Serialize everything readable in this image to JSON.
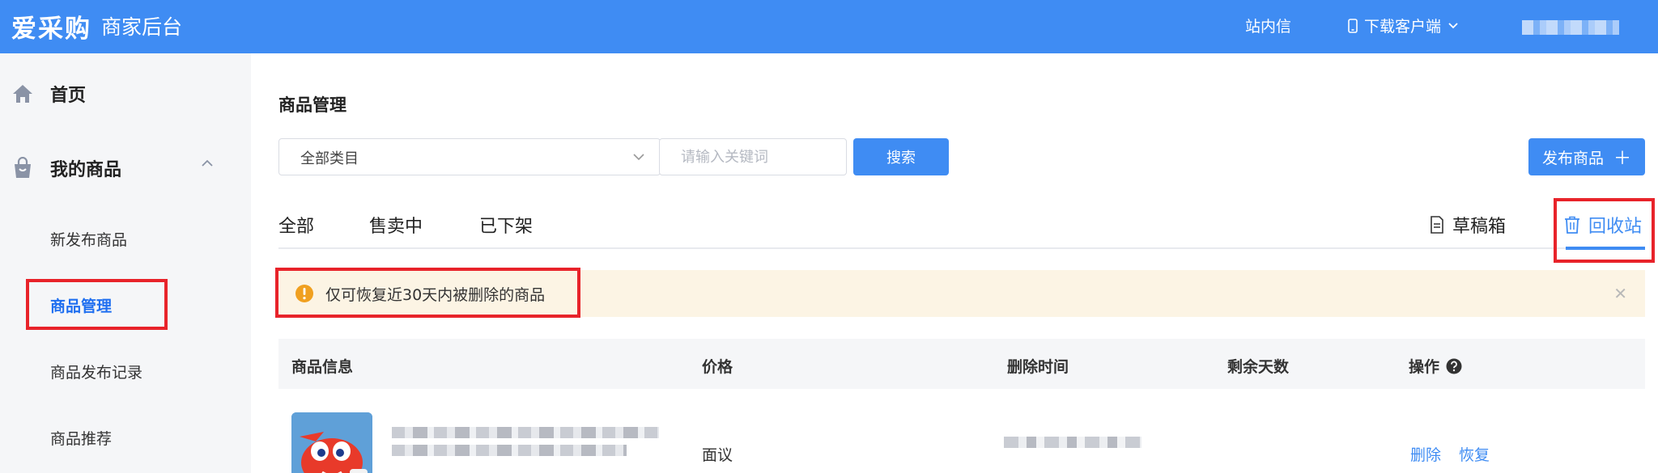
{
  "header": {
    "logo": "爱采购",
    "subtitle": "商家后台",
    "nav_message": "站内信",
    "nav_download": "下载客户端"
  },
  "sidebar": {
    "home": "首页",
    "my_goods": "我的商品",
    "sub_items": [
      {
        "label": "新发布商品"
      },
      {
        "label": "商品管理"
      },
      {
        "label": "商品发布记录"
      },
      {
        "label": "商品推荐"
      }
    ]
  },
  "main": {
    "page_title": "商品管理",
    "category_select": "全部类目",
    "search_placeholder": "请输入关键词",
    "search_button": "搜索",
    "publish_button": "发布商品",
    "tabs": [
      {
        "label": "全部"
      },
      {
        "label": "售卖中"
      },
      {
        "label": "已下架"
      }
    ],
    "draft_tab": "草稿箱",
    "recycle_tab": "回收站",
    "alert_text": "仅可恢复近30天内被删除的商品",
    "table_headers": [
      "商品信息",
      "价格",
      "删除时间",
      "剩余天数",
      "操作"
    ],
    "row": {
      "price": "面议",
      "action_delete": "删除",
      "action_restore": "恢复"
    }
  },
  "colors": {
    "brand": "#3f8cf3",
    "highlight": "#e8232a",
    "alert_bg": "#fcf4e4"
  }
}
